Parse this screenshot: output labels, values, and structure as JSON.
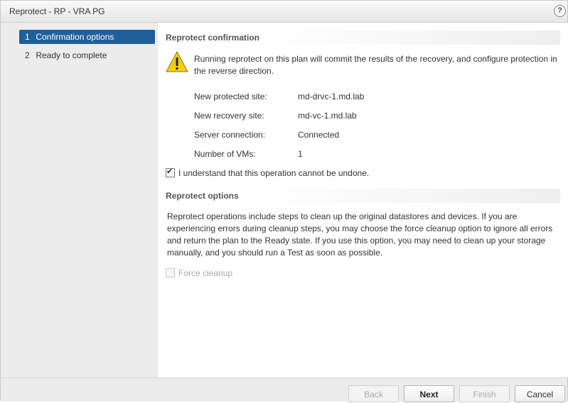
{
  "window": {
    "title": "Reprotect - RP - VRA PG",
    "help_label": "?"
  },
  "sidebar": {
    "steps": [
      {
        "num": "1",
        "label": "Confirmation options",
        "active": true
      },
      {
        "num": "2",
        "label": "Ready to complete",
        "active": false
      }
    ]
  },
  "confirmation": {
    "heading": "Reprotect confirmation",
    "warning": "Running reprotect on this plan will commit the results of the recovery, and configure protection in the reverse direction.",
    "details": [
      {
        "label": "New protected site:",
        "value": "md-drvc-1.md.lab"
      },
      {
        "label": "New recovery site:",
        "value": "md-vc-1.md.lab"
      },
      {
        "label": "Server connection:",
        "value": "Connected"
      },
      {
        "label": "Number of VMs:",
        "value": "1"
      }
    ],
    "acknowledge_label": "I understand that this operation cannot be undone.",
    "acknowledge_checked": true
  },
  "options": {
    "heading": "Reprotect options",
    "description": "Reprotect operations include steps to clean up the original datastores and devices. If you are experiencing errors during cleanup steps, you may choose the force cleanup option to ignore all errors and return the plan to the Ready state. If you use this option, you may need to clean up your storage manually, and you should run a Test as soon as possible.",
    "force_cleanup_label": "Force cleanup",
    "force_cleanup_checked": false,
    "force_cleanup_enabled": false
  },
  "footer": {
    "back_label": "Back",
    "next_label": "Next",
    "finish_label": "Finish",
    "cancel_label": "Cancel"
  },
  "colors": {
    "active_step": "#1f5f9c",
    "warning_fill": "#f5d000"
  },
  "icons": {
    "warning": "warning-triangle-icon",
    "help": "help-icon"
  }
}
